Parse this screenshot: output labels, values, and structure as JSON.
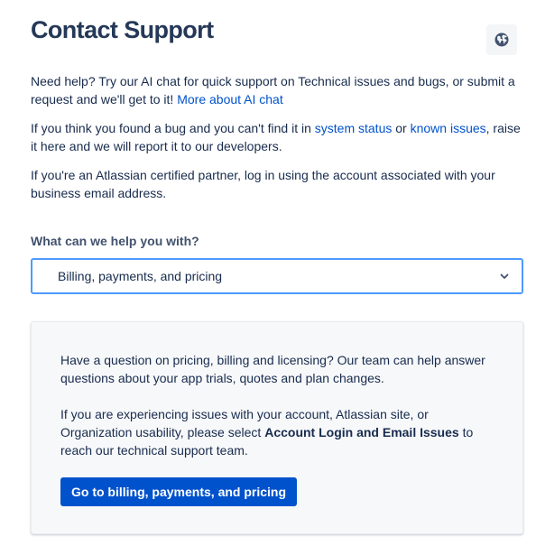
{
  "header": {
    "title": "Contact Support",
    "language_icon": "globe-icon"
  },
  "intro": {
    "p1_text": "Need help? Try our AI chat for quick support on Technical issues and bugs, or submit a request and we'll get to it! ",
    "p1_link": "More about AI chat",
    "p2_before": "If you think you found a bug and you can't find it in ",
    "p2_link1": "system status",
    "p2_mid": " or ",
    "p2_link2": "known issues",
    "p2_after": ", raise it here and we will report it to our developers.",
    "p3_text": "If you're an Atlassian certified partner, log in using the account associated with your business email address."
  },
  "help_form": {
    "label": "What can we help you with?",
    "selected": "Billing, payments, and pricing",
    "chevron_icon": "chevron-down-icon"
  },
  "info_card": {
    "p1": "Have a question on pricing, billing and licensing? Our team can help answer questions about your app trials, quotes and plan changes.",
    "p2_before": "If you are experiencing issues with your account, Atlassian site, or Organization usability, please select ",
    "p2_bold": "Account Login and Email Issues",
    "p2_after": " to reach our technical support team.",
    "button_label": "Go to billing, payments, and pricing"
  },
  "colors": {
    "link": "#0052cc",
    "primary_button": "#0052cc",
    "focus_border": "#4c9aff",
    "title": "#253858"
  }
}
